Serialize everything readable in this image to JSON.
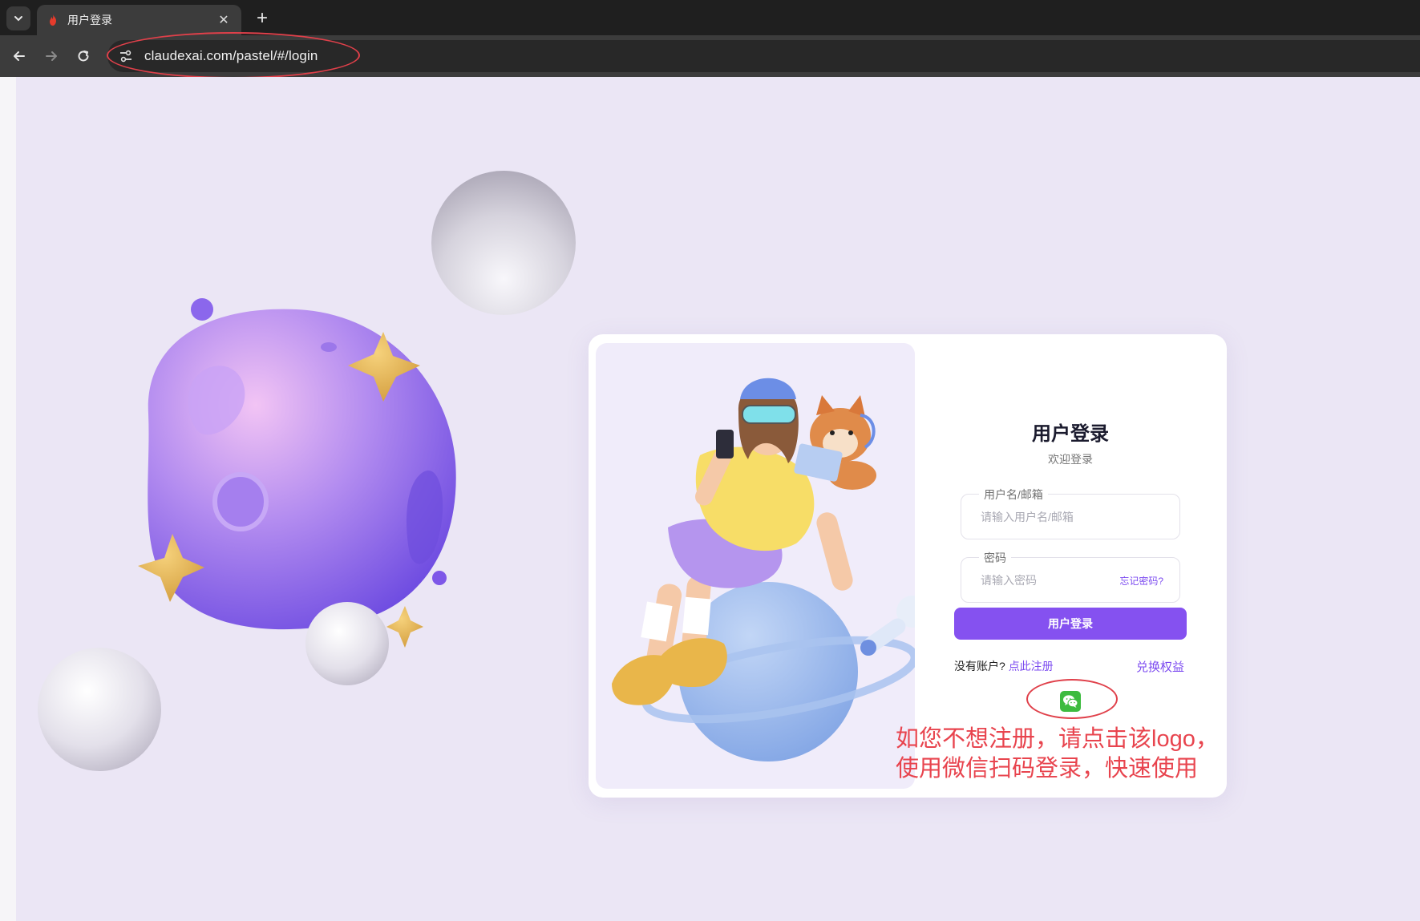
{
  "browser": {
    "tab": {
      "title": "用户登录",
      "close_glyph": "✕"
    },
    "new_tab_glyph": "+",
    "tab_menu_glyph": "⌄",
    "url": "claudexai.com/pastel/#/login"
  },
  "login": {
    "title": "用户登录",
    "subtitle": "欢迎登录",
    "username": {
      "label": "用户名/邮箱",
      "placeholder": "请输入用户名/邮箱"
    },
    "password": {
      "label": "密码",
      "placeholder": "请输入密码",
      "forgot": "忘记密码?"
    },
    "submit_label": "用户登录",
    "no_account_text": "没有账户?",
    "register_link": "点此注册",
    "redeem_link": "兑换权益",
    "wechat_icon": "wechat-icon"
  },
  "annotation": {
    "lines": [
      "如您不想注册，请点击该logo，",
      "使用微信扫码登录，快速使用"
    ],
    "color": "#e8444e"
  },
  "colors": {
    "accent": "#8551f0",
    "link": "#7c4bf0",
    "wechat": "#3dbb3f",
    "page_bg": "#ebe6f5"
  }
}
